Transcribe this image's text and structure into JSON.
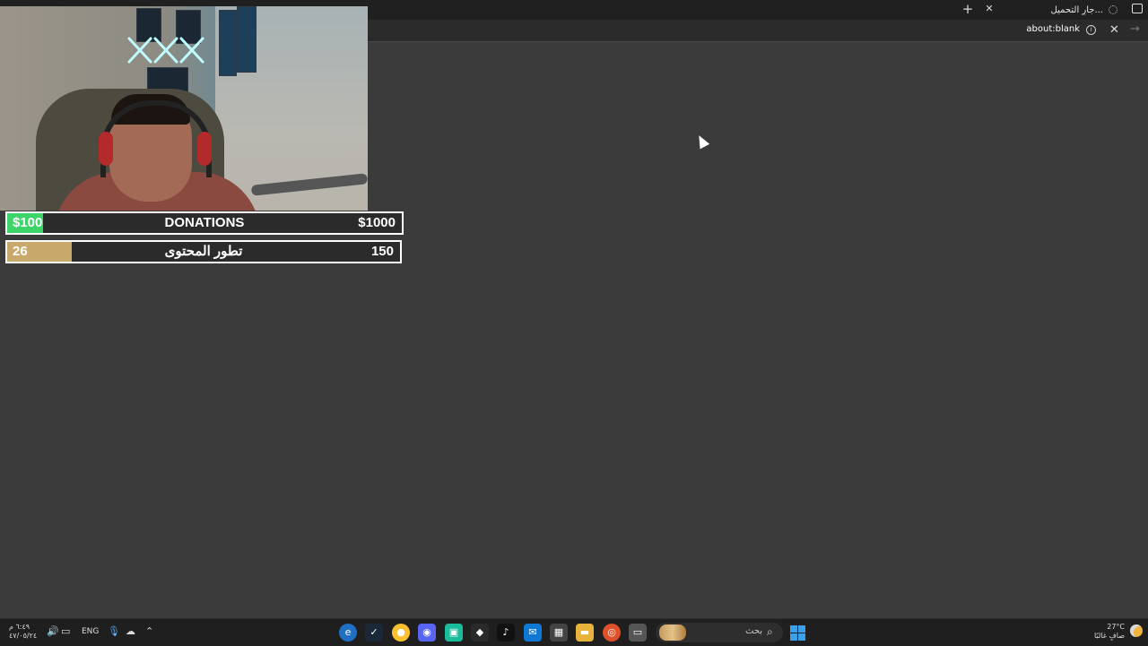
{
  "browser": {
    "tab_title": "...جارٍ التحميل",
    "url": "about:blank"
  },
  "overlay": {
    "donations": {
      "left_label": "$100",
      "title": "DONATIONS",
      "right_label": "$1000",
      "fill_fraction": 0.09,
      "fill_color": "#3dd56a"
    },
    "content": {
      "left_label": "26",
      "title": "تطور المحتوى",
      "right_label": "150",
      "fill_fraction": 0.165,
      "fill_color": "#c9a96b"
    }
  },
  "taskbar": {
    "clock_time": "٦:٤٩ م",
    "clock_date": "٤٧/٠٥/٢٤",
    "language": "ENG",
    "search_placeholder": "بحث",
    "weather_temp": "27°C",
    "weather_desc": "صافٍ غالبًا",
    "apps": [
      "edge-icon",
      "steam-icon",
      "chrome-icon",
      "discord-icon",
      "app-icon",
      "epic-icon",
      "tiktok-icon",
      "outlook-icon",
      "store-icon",
      "explorer-icon",
      "origin-icon",
      "snipping-icon"
    ]
  }
}
